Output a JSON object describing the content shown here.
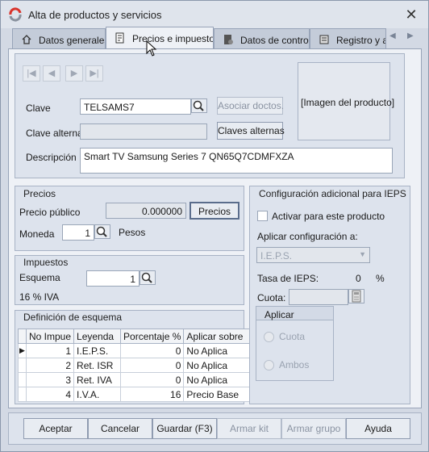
{
  "window": {
    "title": "Alta de productos y servicios",
    "close_glyph": "✕"
  },
  "tabs": [
    {
      "label": "Datos generales",
      "icon": "home-icon"
    },
    {
      "label": "Precios e impuestos",
      "icon": "document-icon"
    },
    {
      "label": "Datos de control",
      "icon": "control-icon"
    },
    {
      "label": "Registro y ac",
      "icon": "registry-icon"
    }
  ],
  "product": {
    "clave_label": "Clave",
    "clave_value": "TELSAMS7",
    "asociar_label": "Asociar doctos.",
    "clave_alterna_label": "Clave alterna",
    "clave_alterna_value": "",
    "claves_alternas_button": "Claves alternas",
    "descripcion_label": "Descripción",
    "descripcion_value": "Smart TV Samsung Series 7 QN65Q7CDMFXZA",
    "image_placeholder": "[Imagen del producto]"
  },
  "precios": {
    "title": "Precios",
    "precio_publico_label": "Precio público",
    "precio_publico_value": "0.000000",
    "precios_button": "Precios",
    "moneda_label": "Moneda",
    "moneda_value": "1",
    "moneda_name": "Pesos"
  },
  "impuestos": {
    "title": "Impuestos",
    "esquema_label": "Esquema",
    "esquema_value": "1",
    "esquema_desc": "16 % IVA"
  },
  "definicion": {
    "title": "Definición de esquema",
    "columns": [
      "No Impue",
      "Leyenda",
      "Porcentaje %",
      "Aplicar sobre"
    ],
    "rows": [
      [
        "1",
        "I.E.P.S.",
        "0",
        "No Aplica"
      ],
      [
        "2",
        "Ret. ISR",
        "0",
        "No Aplica"
      ],
      [
        "3",
        "Ret. IVA",
        "0",
        "No Aplica"
      ],
      [
        "4",
        "I.V.A.",
        "16",
        "Precio Base"
      ]
    ]
  },
  "ieps": {
    "title": "Configuración adicional para IEPS",
    "activar_label": "Activar para este producto",
    "aplicar_config_label": "Aplicar configuración a:",
    "aplicar_config_value": "I.E.P.S.",
    "tasa_label": "Tasa de IEPS:",
    "tasa_value": "0",
    "tasa_unit": "%",
    "cuota_label": "Cuota:",
    "cuota_value": "",
    "aplicar_group": "Aplicar",
    "opt_cuota": "Cuota",
    "opt_ambos": "Ambos"
  },
  "footer": {
    "aceptar": "Aceptar",
    "cancelar": "Cancelar",
    "guardar": "Guardar (F3)",
    "armar_kit": "Armar kit",
    "armar_grupo": "Armar grupo",
    "ayuda": "Ayuda"
  }
}
